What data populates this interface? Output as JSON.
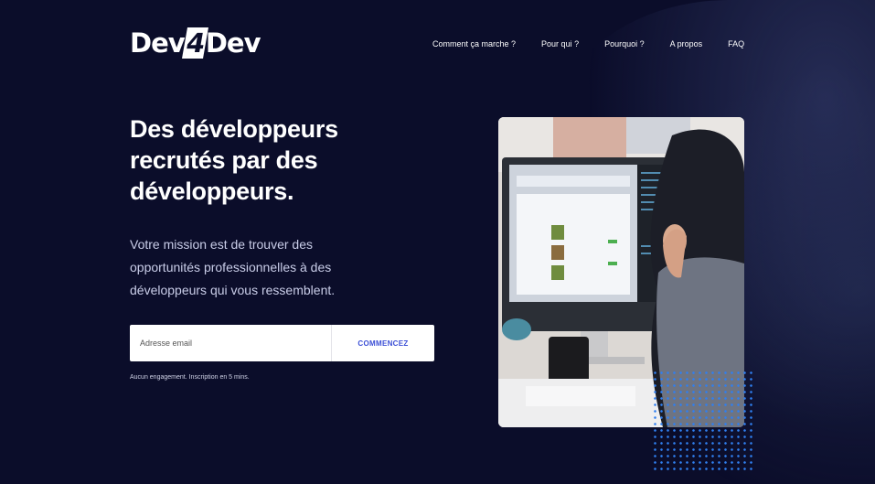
{
  "brand": {
    "logo_pre": "Dev",
    "logo_num": "4",
    "logo_post": "Dev"
  },
  "nav": {
    "items": [
      "Comment ça marche ?",
      "Pour qui ?",
      "Pourquoi ?",
      "A propos",
      "FAQ"
    ]
  },
  "hero": {
    "title": "Des développeurs recrutés par des développeurs.",
    "subtitle": "Votre mission est de trouver des opportunités professionnelles à des développeurs qui vous ressemblent.",
    "email_placeholder": "Adresse email",
    "cta_label": "COMMENCEZ",
    "fineprint": "Aucun engagement. Inscription en 5 mins."
  },
  "colors": {
    "background": "#0b0d2a",
    "accent": "#3b4fd6",
    "dots": "#2f7ff0"
  },
  "icons": {
    "photo": "developer-at-desk-photo"
  }
}
